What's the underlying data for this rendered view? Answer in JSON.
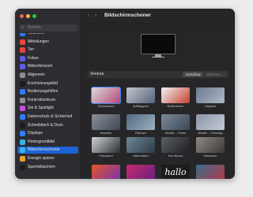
{
  "window": {
    "title": "Bildschirmschoner"
  },
  "sidebar": {
    "search_placeholder": "Suchen",
    "items": [
      {
        "label": "Netzwerk",
        "color": "#2f7cf6"
      },
      {
        "label": "Mitteilungen",
        "color": "#e8453c"
      },
      {
        "label": "Ton",
        "color": "#e8453c"
      },
      {
        "label": "Fokus",
        "color": "#5e5ce6"
      },
      {
        "label": "Bildschirmzeit",
        "color": "#5e5ce6"
      },
      {
        "label": "Allgemein",
        "color": "#8e8e93"
      },
      {
        "label": "Erscheinungsbild",
        "color": "#1c1c1e"
      },
      {
        "label": "Bedienungshilfen",
        "color": "#2f7cf6"
      },
      {
        "label": "Kontrollzentrum",
        "color": "#8e8e93"
      },
      {
        "label": "Siri & Spotlight",
        "color": "#c24fd6"
      },
      {
        "label": "Datenschutz & Sicherheit",
        "color": "#2f7cf6"
      },
      {
        "label": "Schreibtisch & Dock",
        "color": "#1c1c1e"
      },
      {
        "label": "Displays",
        "color": "#2f7cf6"
      },
      {
        "label": "Hintergrundbild",
        "color": "#38b2e8"
      },
      {
        "label": "Bildschirmschoner",
        "color": "#38b2e8",
        "selected": true
      },
      {
        "label": "Energie sparen",
        "color": "#f0a030"
      },
      {
        "label": "Sperrbildschirm",
        "color": "#1c1c1e"
      }
    ]
  },
  "preview": {
    "name": "Ventura",
    "preview_button": "Vorschau",
    "options_button": "Optionen ..."
  },
  "screensavers": [
    {
      "label": "Schwebend",
      "colors": [
        "#d9d9dc",
        "#b64a7a"
      ]
    },
    {
      "label": "Aufklappen",
      "colors": [
        "#c2c7cf",
        "#55637a"
      ]
    },
    {
      "label": "Reflexionen",
      "colors": [
        "#f4f4f6",
        "#c53f2f"
      ]
    },
    {
      "label": "Origami",
      "colors": [
        "#6b7a8f",
        "#aeb8c6"
      ]
    },
    {
      "label": "Kacheln",
      "colors": [
        "#8a9199",
        "#3e4652"
      ]
    },
    {
      "label": "Flächen",
      "colors": [
        "#516b82",
        "#9db1c2"
      ]
    },
    {
      "label": "Mobile – Fotos",
      "colors": [
        "#7c8b99",
        "#3b4653"
      ]
    },
    {
      "label": "Mobile – Feiertag",
      "colors": [
        "#8b95a8",
        "#c4cbd6"
      ]
    },
    {
      "label": "Fotowand",
      "colors": [
        "#cfd3d8",
        "#2a2c30"
      ]
    },
    {
      "label": "Altmodisch",
      "colors": [
        "#6e8797",
        "#2c3b46"
      ]
    },
    {
      "label": "Ken Burns",
      "colors": [
        "#5d5f66",
        "#1d1f24"
      ]
    },
    {
      "label": "Klassisch",
      "colors": [
        "#8e8a86",
        "#3a3735"
      ]
    },
    {
      "label": "",
      "colors": [
        "#e0582a",
        "#7a2fb0"
      ]
    },
    {
      "label": "",
      "colors": [
        "#c52c6e",
        "#6b1f7e"
      ]
    },
    {
      "label": "",
      "colors": [
        "#1c1c1e",
        "#1c1c1e"
      ],
      "text": "hallo"
    },
    {
      "label": "",
      "colors": [
        "#3c6b8a",
        "#b03a4a"
      ]
    }
  ]
}
